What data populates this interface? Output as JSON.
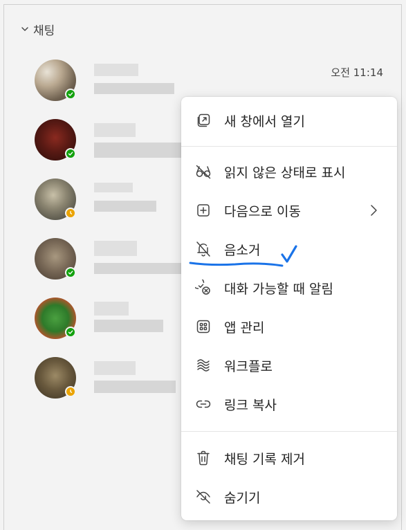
{
  "sidebar": {
    "section_title": "채팅",
    "chats": [
      {
        "timestamp": "오전 11:14",
        "status": "available",
        "status_color": "#13a10e"
      },
      {
        "timestamp": "",
        "status": "available",
        "status_color": "#13a10e"
      },
      {
        "timestamp": "",
        "status": "away",
        "status_color": "#eaa300"
      },
      {
        "timestamp": "",
        "status": "available",
        "status_color": "#13a10e"
      },
      {
        "timestamp": "",
        "status": "available",
        "status_color": "#13a10e"
      },
      {
        "timestamp": "",
        "status": "away",
        "status_color": "#eaa300"
      }
    ]
  },
  "context_menu": {
    "items": [
      {
        "label": "새 창에서 열기",
        "icon": "open-in-new-window-icon"
      },
      {
        "label": "읽지 않은 상태로 표시",
        "icon": "glasses-off-icon"
      },
      {
        "label": "다음으로 이동",
        "icon": "add-square-icon",
        "has_submenu": true
      },
      {
        "label": "음소거",
        "icon": "bell-off-icon"
      },
      {
        "label": "대화 가능할 때 알림",
        "icon": "status-notify-icon"
      },
      {
        "label": "앱 관리",
        "icon": "apps-icon"
      },
      {
        "label": "워크플로",
        "icon": "workflow-icon"
      },
      {
        "label": "링크 복사",
        "icon": "link-icon"
      },
      {
        "label": "채팅 기록 제거",
        "icon": "trash-icon"
      },
      {
        "label": "숨기기",
        "icon": "eye-off-icon"
      }
    ]
  },
  "colors": {
    "accent_annotation": "#1a73e8",
    "available": "#13a10e",
    "away": "#eaa300"
  }
}
